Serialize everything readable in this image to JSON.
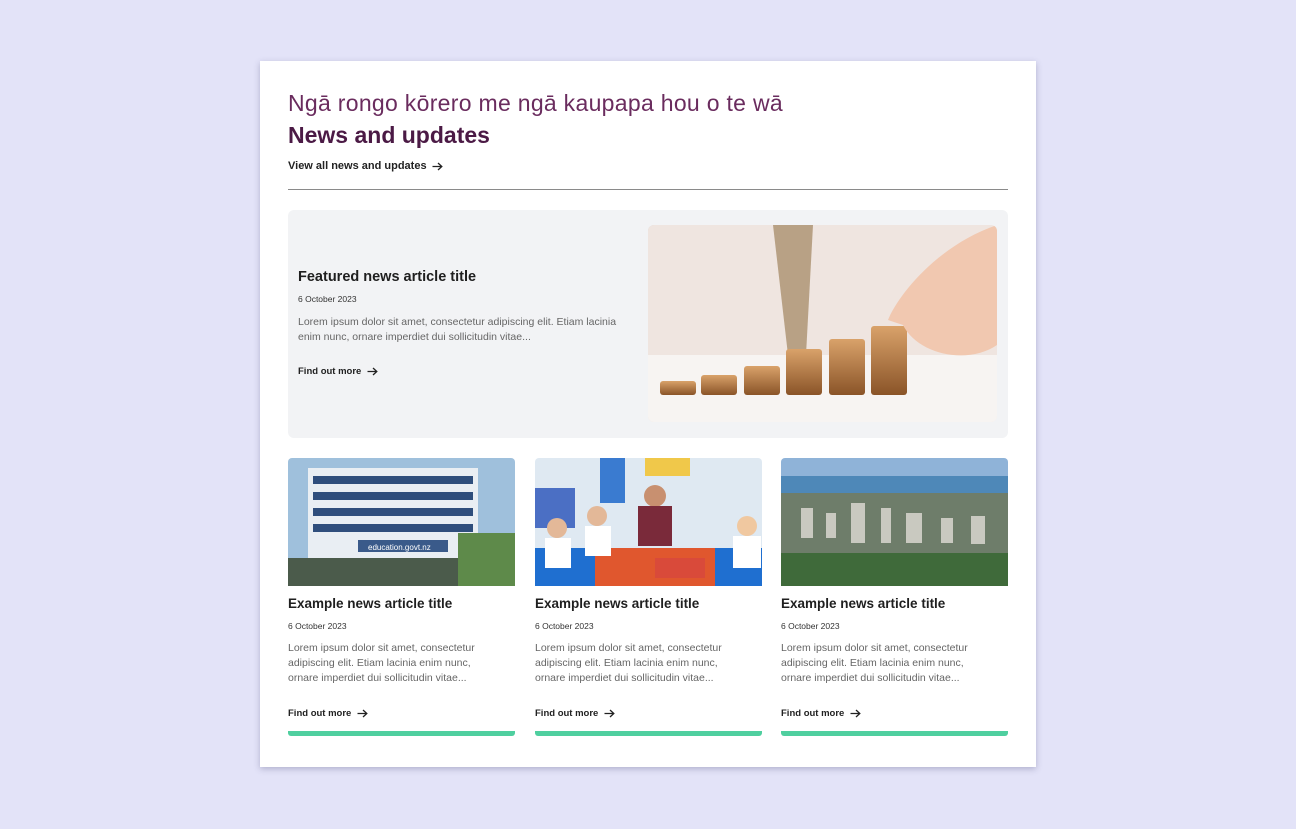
{
  "header": {
    "subtitle": "Ngā rongo kōrero me ngā kaupapa hou o te wā",
    "title": "News and updates",
    "view_all_label": "View all news and updates"
  },
  "featured": {
    "title": "Featured news article title",
    "date": "6 October 2023",
    "excerpt": "Lorem ipsum dolor sit amet, consectetur adipiscing elit. Etiam lacinia enim nunc, ornare imperdiet dui sollicitudin vitae...",
    "link_label": "Find out more",
    "image_icon": "coins-stack-photo"
  },
  "cards": [
    {
      "title": "Example news article title",
      "date": "6 October 2023",
      "excerpt": "Lorem ipsum dolor sit amet, consectetur adipiscing elit. Etiam lacinia enim nunc, ornare imperdiet dui sollicitudin vitae...",
      "link_label": "Find out more",
      "image_icon": "building-photo",
      "sign_text": "education.govt.nz"
    },
    {
      "title": "Example news article title",
      "date": "6 October 2023",
      "excerpt": "Lorem ipsum dolor sit amet, consectetur adipiscing elit. Etiam lacinia enim nunc, ornare imperdiet dui sollicitudin vitae...",
      "link_label": "Find out more",
      "image_icon": "classroom-photo"
    },
    {
      "title": "Example news article title",
      "date": "6 October 2023",
      "excerpt": "Lorem ipsum dolor sit amet, consectetur adipiscing elit. Etiam lacinia enim nunc, ornare imperdiet dui sollicitudin vitae...",
      "link_label": "Find out more",
      "image_icon": "city-aerial-photo"
    }
  ],
  "colors": {
    "page_background": "#e3e3f8",
    "subtitle": "#6a2c5e",
    "title": "#4b1a45",
    "accent_bar": "#4fcf9f",
    "featured_background": "#f2f3f5"
  }
}
